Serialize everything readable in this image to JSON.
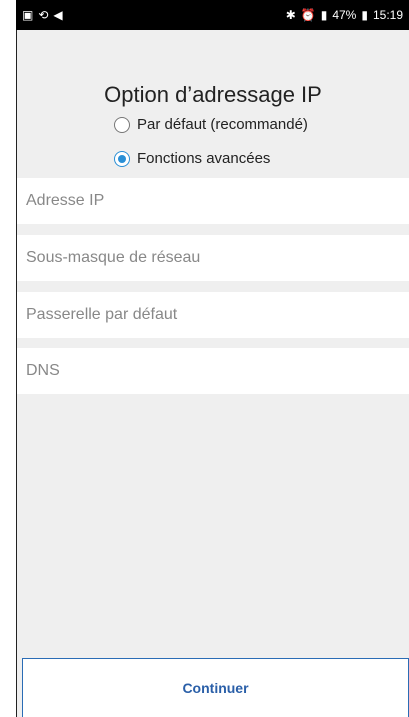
{
  "status_bar": {
    "left_icons": [
      "image-icon",
      "sync-icon",
      "send-icon"
    ],
    "right_icons": [
      "bluetooth-icon",
      "alarm-icon",
      "signal-icon"
    ],
    "battery": "47%",
    "time": "15:19"
  },
  "page": {
    "title": "Option d’adressage IP",
    "options": [
      {
        "label": "Par défaut (recommandé)",
        "selected": false
      },
      {
        "label": "Fonctions avancées",
        "selected": true
      }
    ],
    "fields": [
      {
        "placeholder": "Adresse IP"
      },
      {
        "placeholder": "Sous-masque de réseau"
      },
      {
        "placeholder": "Passerelle par défaut"
      },
      {
        "placeholder": "DNS"
      }
    ],
    "continue_label": "Continuer"
  },
  "colors": {
    "accent": "#2a8fd6",
    "button_text": "#2a5fa8",
    "background": "#efefef"
  }
}
